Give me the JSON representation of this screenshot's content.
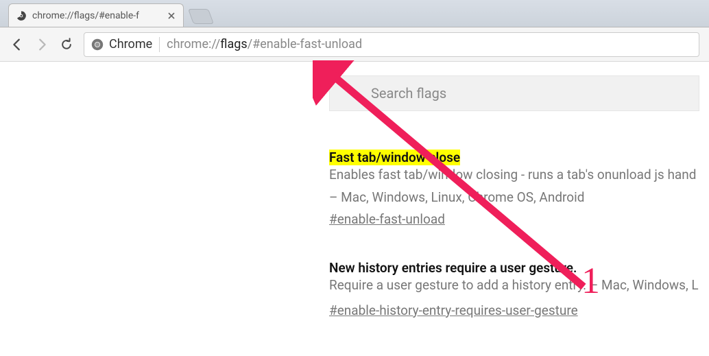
{
  "tab": {
    "title": "chrome://flags/#enable-f"
  },
  "toolbar": {
    "site_label": "Chrome",
    "url_prefix": "chrome://",
    "url_bold": "flags",
    "url_suffix": "/#enable-fast-unload"
  },
  "search": {
    "placeholder": "Search flags"
  },
  "flags": [
    {
      "title": "Fast tab/window close",
      "highlighted": true,
      "description": "Enables fast tab/window closing - runs a tab's onunload js hand",
      "platforms": "– Mac, Windows, Linux, Chrome OS, Android",
      "anchor": "#enable-fast-unload"
    },
    {
      "title": "New history entries require a user gesture.",
      "highlighted": false,
      "description": "Require a user gesture to add a history entry.",
      "platforms": " – Mac, Windows, L",
      "anchor": "#enable-history-entry-requires-user-gesture"
    }
  ],
  "annotation": {
    "number": "1"
  }
}
